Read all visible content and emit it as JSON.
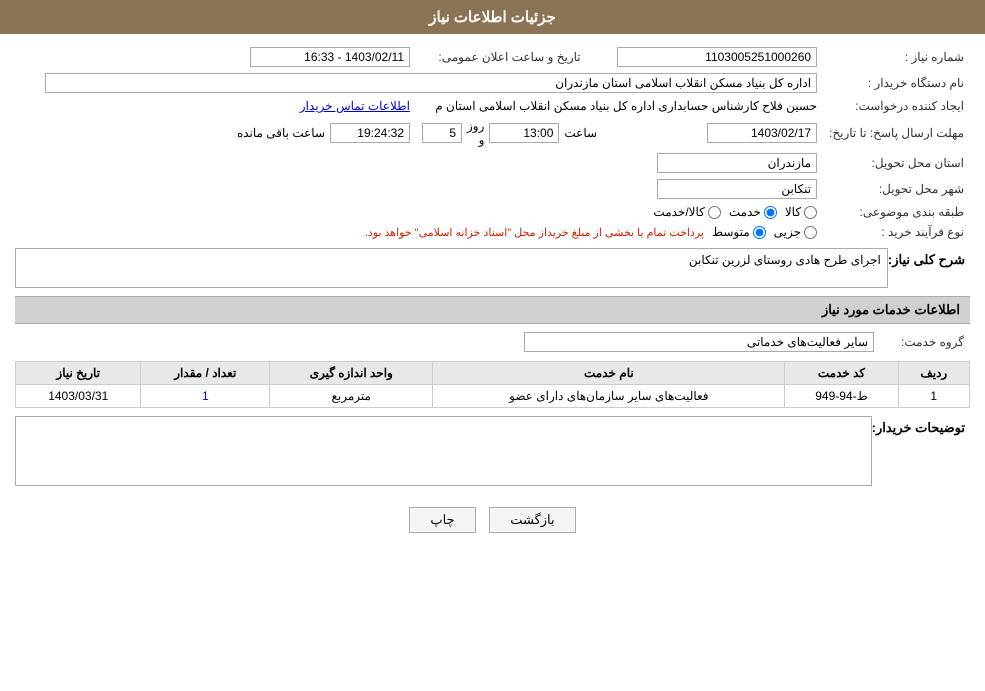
{
  "header": {
    "title": "جزئیات اطلاعات نیاز"
  },
  "fields": {
    "shomara_niaz_label": "شماره نیاز :",
    "shomara_niaz_value": "1103005251000260",
    "nam_dasgah_label": "نام دستگاه خریدار :",
    "nam_dasgah_value": "اداره کل بنیاد مسکن انقلاب اسلامی استان مازندران",
    "tarikh_label": "تاریخ و ساعت اعلان عمومی:",
    "tarikh_value": "1403/02/11 - 16:33",
    "ijad_label": "ایجاد کننده درخواست:",
    "ijad_value": "حسین فلاح کارشناس حسابداری اداره کل بنیاد مسکن انقلاب اسلامی استان م",
    "ijad_link": "اطلاعات تماس خریدار",
    "mohlat_label": "مهلت ارسال پاسخ: تا تاریخ:",
    "mohlat_date": "1403/02/17",
    "mohlat_saat_label": "ساعت",
    "mohlat_saat_value": "13:00",
    "mohlat_rooz_label": "روز و",
    "mohlat_rooz_value": "5",
    "mohlat_mande_label": "ساعت باقی مانده",
    "mohlat_mande_value": "19:24:32",
    "ostan_label": "استان محل تحویل:",
    "ostan_value": "مازندران",
    "shahr_label": "شهر محل تحویل:",
    "shahr_value": "تنکابن",
    "tabaqe_label": "طبقه بندی موضوعی:",
    "tabaqe_options": [
      "کالا",
      "خدمت",
      "کالا/خدمت"
    ],
    "tabaqe_selected": "خدمت",
    "nooe_label": "نوع فرآیند خرید :",
    "nooe_options": [
      "جزیی",
      "متوسط"
    ],
    "nooe_selected": "متوسط",
    "nooe_note": "پرداخت تمام یا بخشی از مبلغ خریداز محل \"اسناد خزانه اسلامی\" خواهد بود.",
    "sharh_label": "شرح کلی نیاز:",
    "sharh_value": "اجرای طرح هادی روستای لزرین تنکابن",
    "service_section_label": "اطلاعات خدمات مورد نیاز",
    "gorooh_label": "گروه خدمت:",
    "gorooh_value": "سایر فعالیت‌های خدماتی",
    "service_table": {
      "headers": [
        "ردیف",
        "کد خدمت",
        "نام خدمت",
        "واحد اندازه گیری",
        "تعداد / مقدار",
        "تاریخ نیاز"
      ],
      "rows": [
        {
          "radif": "1",
          "kod": "ط-94-949",
          "name": "فعالیت‌های سایر سازمان‌های دارای عضو",
          "vahed": "مترمربع",
          "tedad": "1",
          "tarikh": "1403/03/31"
        }
      ]
    },
    "tosif_label": "توضیحات خریدار:",
    "tosif_value": ""
  },
  "buttons": {
    "print_label": "چاپ",
    "back_label": "بازگشت"
  }
}
